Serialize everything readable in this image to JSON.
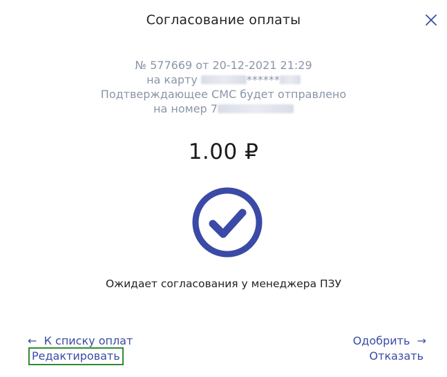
{
  "dialog": {
    "title": "Согласование оплаты",
    "close_icon": "close-icon"
  },
  "info": {
    "line1": "№ 577669 от 20-12-2021 21:29",
    "line2_prefix": "на карту ",
    "line2_stars": "******",
    "line3": "Подтверждающее СМС будет отправлено",
    "line4_prefix": "на номер 7"
  },
  "amount": "1.00 ₽",
  "status": {
    "icon": "check-circle-icon",
    "text": "Ожидает согласования у менеджера ПЗУ"
  },
  "actions": {
    "back_arrow": "←",
    "back_label": "К списку оплат",
    "edit_label": "Редактировать",
    "approve_label": "Одобрить",
    "approve_arrow": "→",
    "decline_label": "Отказать"
  },
  "colors": {
    "accent": "#3a4aa6",
    "info_text": "#8a95a8",
    "focus_outline": "#2e8b2e"
  }
}
